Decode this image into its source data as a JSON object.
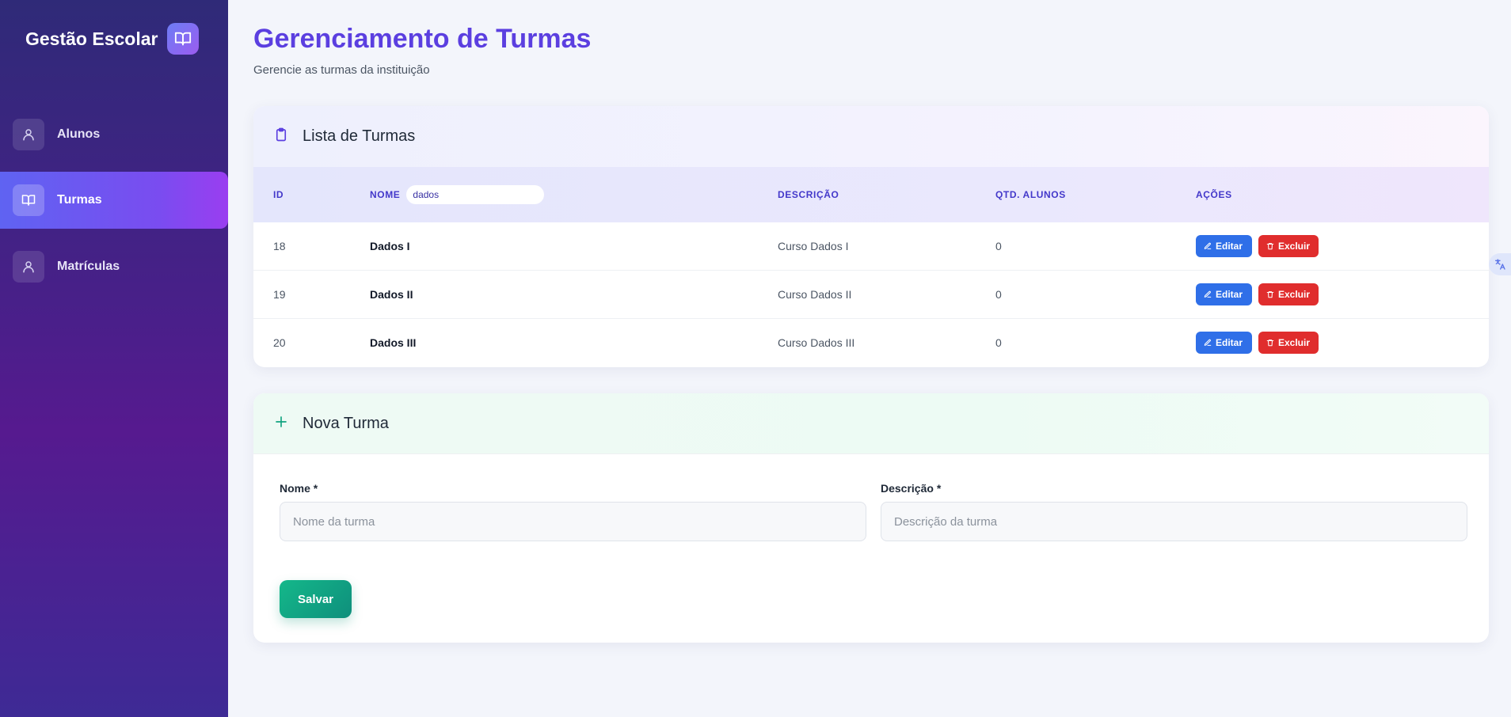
{
  "sidebar": {
    "brand": "Gestão Escolar",
    "brand_icon": "book-open-icon",
    "items": [
      {
        "label": "Alunos",
        "icon": "user-icon",
        "active": false
      },
      {
        "label": "Turmas",
        "icon": "book-open-icon",
        "active": true
      },
      {
        "label": "Matrículas",
        "icon": "user-icon",
        "active": false
      }
    ]
  },
  "header": {
    "title": "Gerenciamento de Turmas",
    "subtitle": "Gerencie as turmas da instituição"
  },
  "list": {
    "title": "Lista de Turmas",
    "icon": "clipboard-icon",
    "columns": {
      "id": "ID",
      "nome": "NOME",
      "descricao": "DESCRIÇÃO",
      "qtd": "QTD. ALUNOS",
      "acoes": "AÇÕES"
    },
    "filter_value": "dados",
    "edit_label": "Editar",
    "delete_label": "Excluir",
    "rows": [
      {
        "id": "18",
        "nome": "Dados I",
        "descricao": "Curso Dados I",
        "qtd": "0"
      },
      {
        "id": "19",
        "nome": "Dados II",
        "descricao": "Curso Dados II",
        "qtd": "0"
      },
      {
        "id": "20",
        "nome": "Dados III",
        "descricao": "Curso Dados III",
        "qtd": "0"
      }
    ]
  },
  "form": {
    "title": "Nova Turma",
    "icon": "plus-icon",
    "nome_label": "Nome *",
    "nome_placeholder": "Nome da turma",
    "descricao_label": "Descrição *",
    "descricao_placeholder": "Descrição da turma",
    "save_label": "Salvar"
  },
  "colors": {
    "accent": "#5b3fe0",
    "edit": "#2f6fe8",
    "delete": "#e02d2d",
    "save": "#14b88a"
  }
}
